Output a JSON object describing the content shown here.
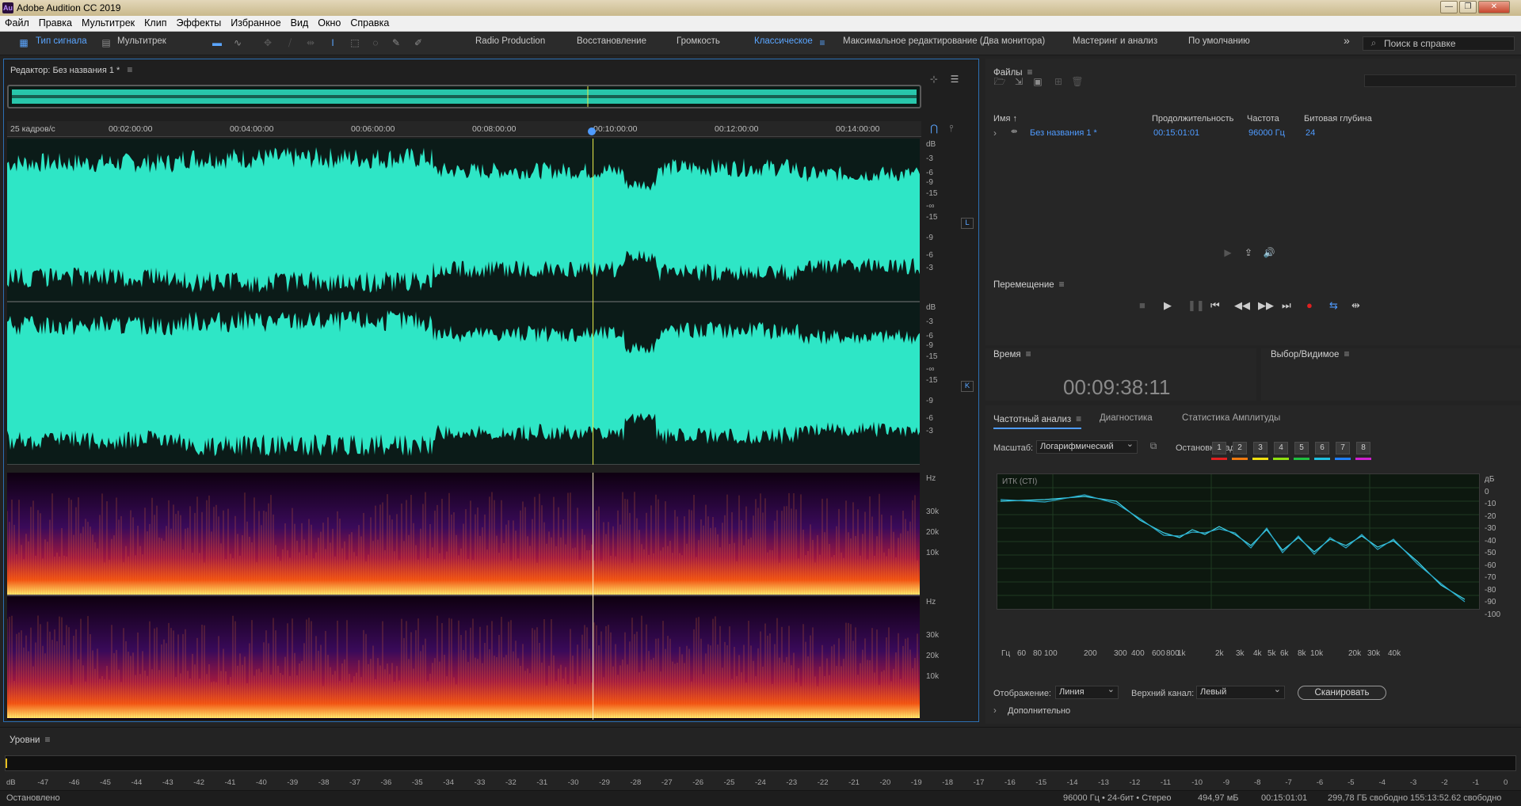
{
  "window": {
    "app_icon": "Au",
    "title": "Adobe Audition CC 2019",
    "minimize": "—",
    "maximize": "❐",
    "close": "✕"
  },
  "menu": [
    "Файл",
    "Правка",
    "Мультитрек",
    "Клип",
    "Эффекты",
    "Избранное",
    "Вид",
    "Окно",
    "Справка"
  ],
  "toolbar": {
    "waveform_label": "Тип сигнала",
    "multitrack_label": "Мультитрек",
    "workspaces": [
      "Radio Production",
      "Восстановление",
      "Громкость",
      "Классическое",
      "Максимальное редактирование (Два монитора)",
      "Мастеринг и анализ",
      "По умолчанию"
    ],
    "active_workspace": "Классическое",
    "overflow": "»",
    "search_placeholder": "Поиск в справке"
  },
  "editor": {
    "title": "Редактор: Без названия 1 *",
    "timecode_format": "25 кадров/с",
    "ticks": [
      "00:02:00:00",
      "00:04:00:00",
      "00:06:00:00",
      "00:08:00:00",
      "00:10:00:00",
      "00:12:00:00",
      "00:14:00:00"
    ],
    "playhead_fraction": 0.642,
    "db_labels": [
      "dB",
      "-3",
      "-6",
      "-9",
      "-15",
      "-∞",
      "-15",
      "-9",
      "-6",
      "-3"
    ],
    "hz_labels": [
      "Hz",
      "30k",
      "20k",
      "10k"
    ],
    "channel_left": "L",
    "channel_right": "K",
    "waveform_color": "#2ee6c6"
  },
  "files": {
    "title": "Файлы",
    "columns": [
      "Имя ↑",
      "Продолжительность",
      "Частота",
      "Битовая глубина"
    ],
    "rows": [
      {
        "name": "Без названия 1 *",
        "duration": "00:15:01:01",
        "rate": "96000 Гц",
        "depth": "24"
      }
    ]
  },
  "transport": {
    "title": "Перемещение"
  },
  "time": {
    "title": "Время",
    "value": "00:09:38:11"
  },
  "selection": {
    "title": "Выбор/Видимое"
  },
  "freq": {
    "tabs": [
      "Частотный анализ",
      "Диагностика",
      "Статистика Амплитуды"
    ],
    "scale_label": "Масштаб:",
    "scale_value": "Логарифмический",
    "freeze_label": "Остановка кадра:",
    "frames": [
      "1",
      "2",
      "3",
      "4",
      "5",
      "6",
      "7",
      "8"
    ],
    "frame_colors": [
      "#e02020",
      "#f07a10",
      "#f0e010",
      "#90e010",
      "#20c040",
      "#20c0e0",
      "#2080ff",
      "#d020d0"
    ],
    "graph_label": "ИТК (СТІ)",
    "x_labels": [
      "Гц",
      "60",
      "80",
      "100",
      "200",
      "300",
      "400",
      "600",
      "800",
      "1k",
      "2k",
      "3k",
      "4k",
      "5k",
      "6k",
      "8k",
      "10k",
      "20k",
      "30k",
      "40k"
    ],
    "y_labels": [
      "дБ",
      "0",
      "-10",
      "-20",
      "-30",
      "-40",
      "-50",
      "-60",
      "-70",
      "-80",
      "-90",
      "-100"
    ],
    "display_label": "Отображение:",
    "display_value": "Линия",
    "channel_label": "Верхний канал:",
    "channel_value": "Левый",
    "scan_label": "Сканировать",
    "more_label": "Дополнительно"
  },
  "levels": {
    "title": "Уровни",
    "scale": [
      "dB",
      "-47",
      "-46",
      "-45",
      "-44",
      "-43",
      "-42",
      "-41",
      "-40",
      "-39",
      "-38",
      "-37",
      "-36",
      "-35",
      "-34",
      "-33",
      "-32",
      "-31",
      "-30",
      "-29",
      "-28",
      "-27",
      "-26",
      "-25",
      "-24",
      "-23",
      "-22",
      "-21",
      "-20",
      "-19",
      "-18",
      "-17",
      "-16",
      "-15",
      "-14",
      "-13",
      "-12",
      "-11",
      "-10",
      "-9",
      "-8",
      "-7",
      "-6",
      "-5",
      "-4",
      "-3",
      "-2",
      "-1",
      "0"
    ]
  },
  "status": {
    "left": "Остановлено",
    "format": "96000 Гц • 24-бит • Стерео",
    "size": "494,97 мБ",
    "duration": "00:15:01:01",
    "free": "299,78 ГБ свободно",
    "time_free": "155:13:52.62 свободно"
  }
}
